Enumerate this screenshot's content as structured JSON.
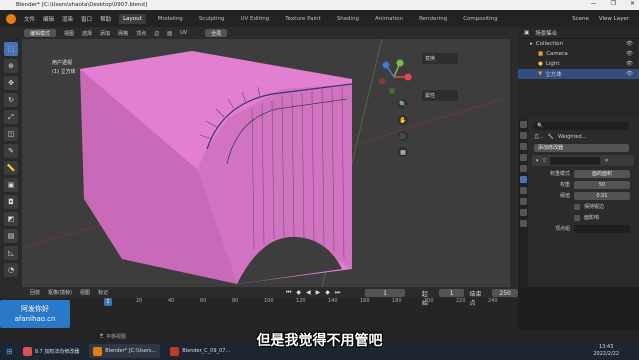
{
  "window": {
    "title": "Blender* [C:\\Users\\shaota\\Desktop\\0907.blend]",
    "controls": [
      "—",
      "❐",
      "✕"
    ]
  },
  "menubar": {
    "items": [
      "文件",
      "编辑",
      "渲染",
      "窗口",
      "帮助"
    ],
    "workspaces": [
      "Layout",
      "Modeling",
      "Sculpting",
      "UV Editing",
      "Texture Paint",
      "Shading",
      "Animation",
      "Rendering",
      "Compositing"
    ],
    "active_workspace": "Layout",
    "scene_label": "Scene",
    "view_layer_label": "View Layer"
  },
  "viewport_header": {
    "mode": "编辑模式",
    "menus": [
      "视图",
      "选择",
      "添加",
      "网格",
      "顶点",
      "边",
      "面",
      "UV"
    ],
    "transform": "全局"
  },
  "viewport": {
    "view_name": "用户透视",
    "object_name": "(1) 立方体",
    "side_tabs": [
      "变换",
      "属性"
    ],
    "nav_icons": [
      "zoom-icon",
      "hand-icon",
      "camera-icon",
      "grid-icon"
    ],
    "colors": {
      "background": "#3d3d3d",
      "mesh": "#e27fd1",
      "axis_x": "#e8474b",
      "axis_y": "#7bc043",
      "axis_z": "#3c7ad6"
    }
  },
  "toolbar": {
    "tools": [
      "select-icon",
      "cursor-icon",
      "move-icon",
      "rotate-icon",
      "scale-icon",
      "transform-icon",
      "annotate-icon",
      "measure-icon",
      "extrude-icon",
      "inset-icon",
      "bevel-icon",
      "loopcut-icon",
      "knife-icon",
      "polybuild-icon",
      "spin-icon",
      "smooth-icon",
      "edge-slide-icon",
      "shrink-icon",
      "shear-icon",
      "rip-icon"
    ]
  },
  "outliner": {
    "header": "场景集合",
    "rows": [
      {
        "label": "Collection",
        "indent": 1
      },
      {
        "label": "Camera",
        "indent": 2
      },
      {
        "label": "Light",
        "indent": 2
      },
      {
        "label": "立方体",
        "indent": 2,
        "selected": true
      }
    ]
  },
  "properties": {
    "object": "立...",
    "modifier_name": "Weighted...",
    "add_modifier": "添加修改器",
    "rows": [
      {
        "label": "权重模式",
        "value": "面的面积"
      },
      {
        "label": "权重",
        "value": "50"
      },
      {
        "label": "阈值",
        "value": "0.01"
      }
    ],
    "checks": [
      "保持锐边",
      "面影响"
    ],
    "vertex_group_label": "顶点组"
  },
  "timeline": {
    "menus": [
      "回放",
      "抠像(插帧)",
      "视图",
      "标记"
    ],
    "current_frame": "1",
    "start_label": "起始",
    "start": "1",
    "end_label": "结束点",
    "end": "250",
    "ticks": [
      "0",
      "20",
      "40",
      "60",
      "80",
      "100",
      "120",
      "140",
      "160",
      "180",
      "200",
      "220",
      "240"
    ]
  },
  "statusbar": {
    "text": "平移视图"
  },
  "watermark": {
    "line1": "阿发你好",
    "line2": "afanihao.cn"
  },
  "subtitle": "但是我觉得不用管吧",
  "taskbar": {
    "items": [
      {
        "label": "9.7 加权法向修改器",
        "color": "#d9534f"
      },
      {
        "label": "Blender* [C:\\Users...",
        "color": "#e87d0d"
      },
      {
        "label": "Blender_C_09_07...",
        "color": "#c0392b"
      }
    ],
    "time": "13:43",
    "date": "2022/2/22"
  }
}
